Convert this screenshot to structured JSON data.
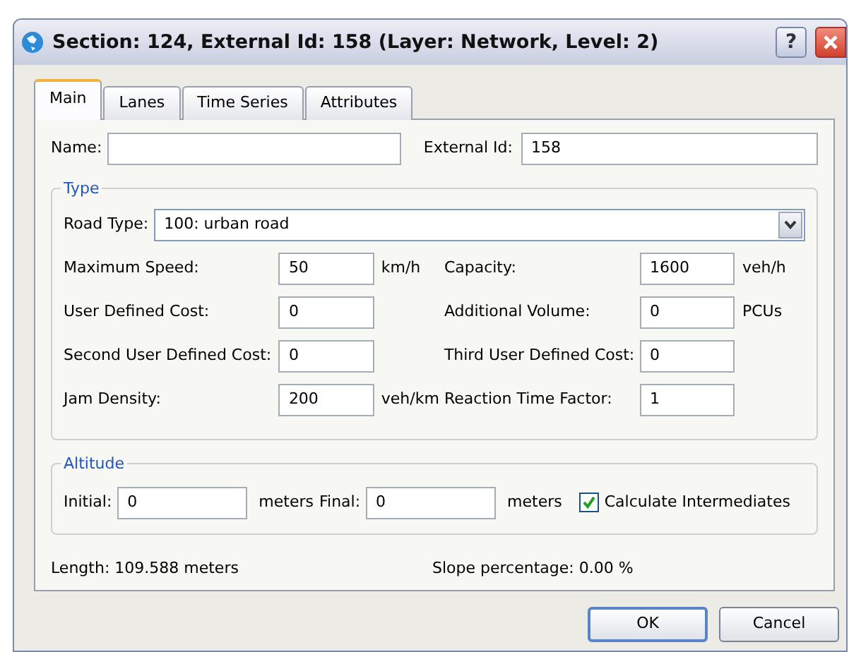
{
  "window": {
    "title": "Section: 124, External Id: 158 (Layer: Network, Level: 2)",
    "help": "?"
  },
  "tabs": [
    {
      "label": "Main",
      "selected": true
    },
    {
      "label": "Lanes",
      "selected": false
    },
    {
      "label": "Time Series",
      "selected": false
    },
    {
      "label": "Attributes",
      "selected": false
    }
  ],
  "name_field": {
    "label": "Name:"
  },
  "external_id": {
    "label": "External Id:",
    "value": "158"
  },
  "type_group": {
    "title": "Type",
    "road_type": {
      "label": "Road Type:",
      "value": "100: urban road"
    },
    "rows": [
      {
        "left": {
          "label": "Maximum Speed:",
          "value": "50",
          "unit": "km/h"
        },
        "right": {
          "label": "Capacity:",
          "value": "1600",
          "unit": "veh/h"
        }
      },
      {
        "left": {
          "label": "User Defined Cost:",
          "value": "0"
        },
        "right": {
          "label": "Additional Volume:",
          "value": "0",
          "unit": "PCUs"
        }
      },
      {
        "left": {
          "label": "Second User Defined Cost:",
          "value": "0"
        },
        "right": {
          "label": "Third User Defined Cost:",
          "value": "0"
        }
      },
      {
        "left": {
          "label": "Jam Density:",
          "value": "200",
          "unit": "veh/km"
        },
        "right": {
          "label": "Reaction Time Factor:",
          "value": "1"
        }
      }
    ]
  },
  "altitude_group": {
    "title": "Altitude",
    "initial": {
      "label": "Initial:",
      "value": "0",
      "unit": "meters"
    },
    "final": {
      "label": "Final:",
      "value": "0",
      "unit": "meters"
    },
    "calculate_intermediates": {
      "label": "Calculate Intermediates",
      "checked": true
    }
  },
  "info": {
    "length": "Length: 109.588 meters",
    "slope": "Slope percentage: 0.00 %"
  },
  "buttons": [
    {
      "label": "OK",
      "default": true
    },
    {
      "label": "Cancel",
      "default": false
    }
  ]
}
